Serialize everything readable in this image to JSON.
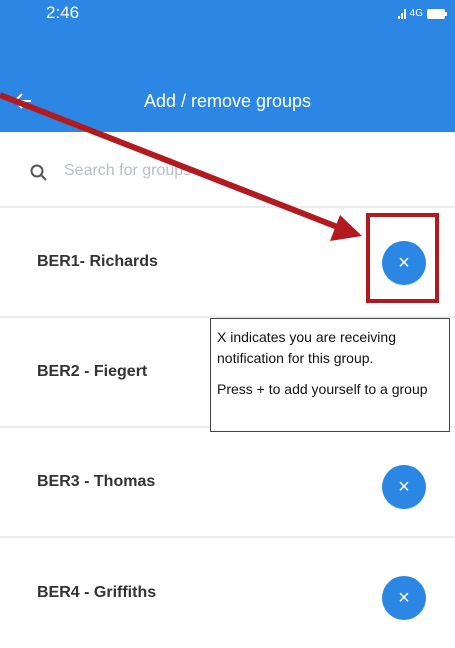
{
  "status_bar": {
    "time": "2:46",
    "network": "4G"
  },
  "app_bar": {
    "title": "Add / remove groups"
  },
  "search": {
    "placeholder": "Search for groups",
    "value": ""
  },
  "groups": [
    {
      "name": "BER1- Richards",
      "toggle": "×"
    },
    {
      "name": "BER2 - Fiegert",
      "toggle": "×"
    },
    {
      "name": "BER3 - Thomas",
      "toggle": "×"
    },
    {
      "name": "BER4 - Griffiths",
      "toggle": "×"
    }
  ],
  "annotation": {
    "line1": "X indicates you are receiving notification for this group.",
    "line2": "Press + to add yourself to a group"
  },
  "colors": {
    "primary": "#2c86e3",
    "annotation_red": "#b21a1f"
  }
}
